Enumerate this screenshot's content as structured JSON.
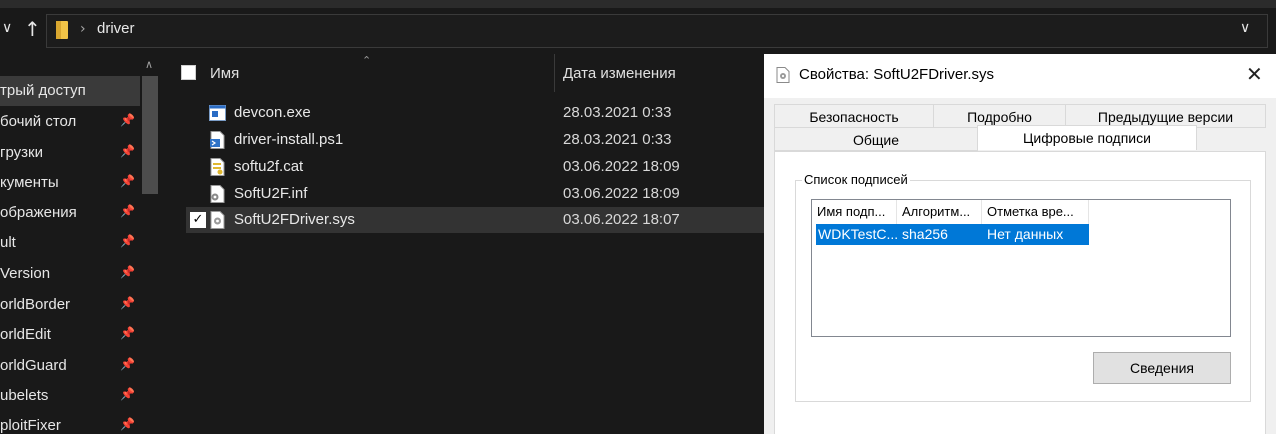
{
  "address": {
    "back_icon": "chevron-down-icon",
    "up_icon": "arrow-up-icon",
    "folder_icon": "folder-icon",
    "crumb": "driver",
    "dropdown_icon": "chevron-down-icon"
  },
  "sidebar": {
    "items": [
      {
        "label": "трый доступ",
        "pinned": false,
        "selected": true
      },
      {
        "label": "бочий стол",
        "pinned": true
      },
      {
        "label": "грузки",
        "pinned": true
      },
      {
        "label": "кументы",
        "pinned": true
      },
      {
        "label": "ображения",
        "pinned": true
      },
      {
        "label": "ult",
        "pinned": true
      },
      {
        "label": "Version",
        "pinned": true
      },
      {
        "label": "orldBorder",
        "pinned": true
      },
      {
        "label": "orldEdit",
        "pinned": true
      },
      {
        "label": "orldGuard",
        "pinned": true
      },
      {
        "label": "ubelets",
        "pinned": true
      },
      {
        "label": "ploitFixer",
        "pinned": true
      }
    ]
  },
  "filelist": {
    "col_name": "Имя",
    "col_date": "Дата изменения",
    "files": [
      {
        "name": "devcon.exe",
        "date": "28.03.2021 0:33",
        "icon": "exe-icon",
        "selected": false
      },
      {
        "name": "driver-install.ps1",
        "date": "28.03.2021 0:33",
        "icon": "powershell-script-icon",
        "selected": false
      },
      {
        "name": "softu2f.cat",
        "date": "03.06.2022 18:09",
        "icon": "security-catalog-icon",
        "selected": false
      },
      {
        "name": "SoftU2F.inf",
        "date": "03.06.2022 18:09",
        "icon": "setup-info-icon",
        "selected": false
      },
      {
        "name": "SoftU2FDriver.sys",
        "date": "03.06.2022 18:07",
        "icon": "system-file-icon",
        "selected": true
      }
    ]
  },
  "dialog": {
    "title": "Свойства: SoftU2FDriver.sys",
    "tabs_row1": [
      "Безопасность",
      "Подробно",
      "Предыдущие версии"
    ],
    "tabs_row2": [
      "Общие",
      "Цифровые подписи"
    ],
    "active_tab": "Цифровые подписи",
    "group_label": "Список подписей",
    "columns": [
      "Имя подп...",
      "Алгоритм...",
      "Отметка вре..."
    ],
    "rows": [
      [
        "WDKTestC...",
        "sha256",
        "Нет данных"
      ]
    ],
    "details_button": "Сведения"
  }
}
